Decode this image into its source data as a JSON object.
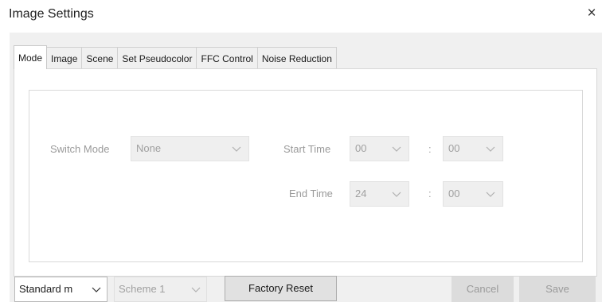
{
  "window": {
    "title": "Image Settings",
    "close_glyph": "×"
  },
  "tabs": [
    "Mode",
    "Image",
    "Scene",
    "Set Pseudocolor",
    "FFC Control",
    "Noise Reduction"
  ],
  "active_tab": "Mode",
  "mode": {
    "switch_mode_label": "Switch Mode",
    "switch_mode_value": "None",
    "start_time_label": "Start Time",
    "start_hour": "00",
    "start_minute": "00",
    "end_time_label": "End Time",
    "end_hour": "24",
    "end_minute": "00",
    "separator": ":"
  },
  "footer": {
    "preset_value": "Standard m",
    "scheme_value": "Scheme 1",
    "factory_reset_label": "Factory Reset",
    "cancel_label": "Cancel",
    "save_label": "Save"
  },
  "icons": {
    "dropdown": "chevron-down-icon",
    "close": "close-icon"
  },
  "colors": {
    "disabled_text": "#a0a0a0",
    "disabled_bg": "#efefef",
    "panel_bg": "#f0f0f0"
  }
}
